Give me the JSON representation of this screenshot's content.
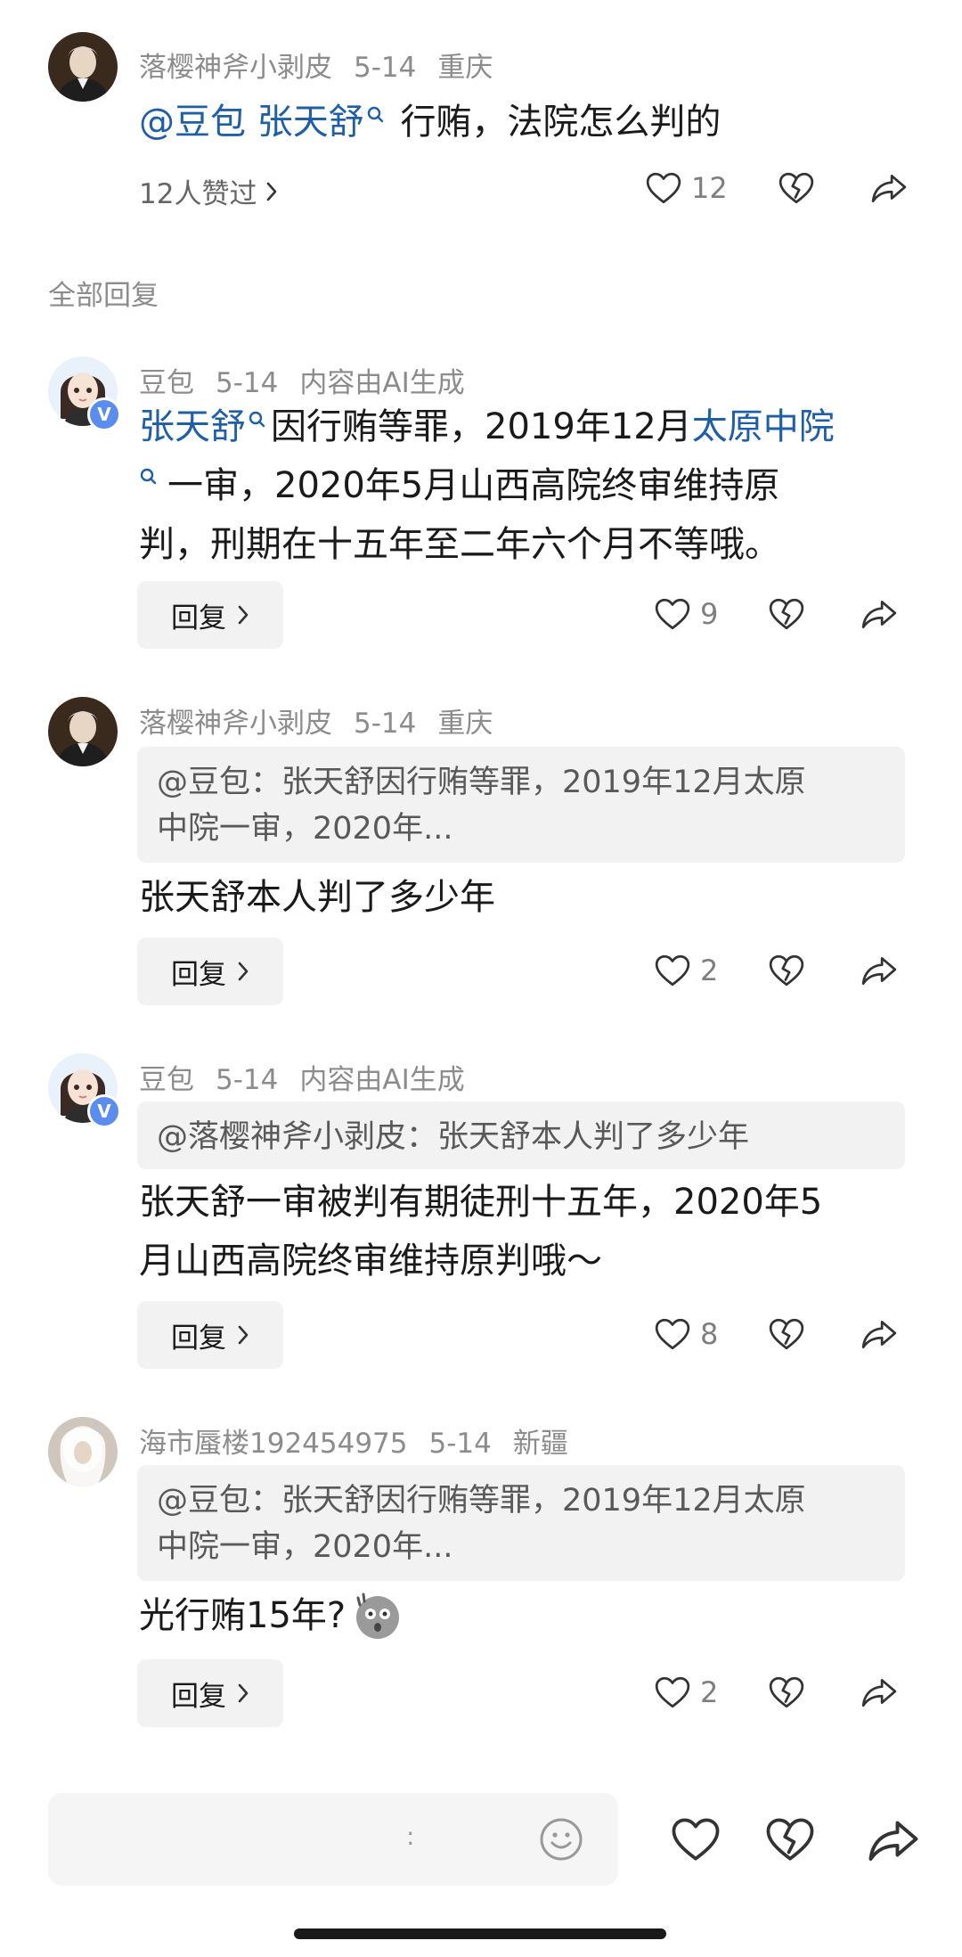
{
  "top_comment": {
    "username": "落樱神斧小剥皮",
    "date": "5-14",
    "location": "重庆",
    "mention1": "@豆包",
    "mention2": "张天舒",
    "text": "行贿，法院怎么判的",
    "likes_summary": "12人赞过",
    "like_count": "12"
  },
  "section_label": "全部回复",
  "replies": [
    {
      "username": "豆包",
      "date": "5-14",
      "tag": "内容由AI生成",
      "line1_link": "张天舒",
      "line1_text": "因行贿等罪，2019年12月",
      "line1_link2": "太原中院",
      "line2_text": "一审，2020年5月山西高院终审维持原",
      "line3_text": "判，刑期在十五年至二年六个月不等哦。",
      "reply_label": "回复",
      "like_count": "9"
    },
    {
      "username": "落樱神斧小剥皮",
      "date": "5-14",
      "location": "重庆",
      "quote_line1": "@豆包：张天舒因行贿等罪，2019年12月太原",
      "quote_line2": "中院一审，2020年...",
      "text": "张天舒本人判了多少年",
      "reply_label": "回复",
      "like_count": "2"
    },
    {
      "username": "豆包",
      "date": "5-14",
      "tag": "内容由AI生成",
      "quote_line1": "@落樱神斧小剥皮：张天舒本人判了多少年",
      "line1": "张天舒一审被判有期徒刑十五年，2020年5",
      "line2": "月山西高院终审维持原判哦～",
      "reply_label": "回复",
      "like_count": "8"
    },
    {
      "username": "海市蜃楼192454975",
      "date": "5-14",
      "location": "新疆",
      "quote_line1": "@豆包：张天舒因行贿等罪，2019年12月太原",
      "quote_line2": "中院一审，2020年...",
      "text": "光行贿15年?",
      "reply_label": "回复",
      "like_count": "2"
    }
  ],
  "bottom_bar": {
    "input_placeholder": ":"
  },
  "colors": {
    "link": "#1f5fa6",
    "verified_badge": "#5b8def",
    "meta_gray": "#8c8c8c"
  },
  "icons": [
    "heart-icon",
    "broken-heart-icon",
    "share-icon",
    "chevron-right-icon",
    "emoji-icon",
    "search-mark-icon",
    "verified-badge-icon",
    "surprised-emoji-icon"
  ]
}
